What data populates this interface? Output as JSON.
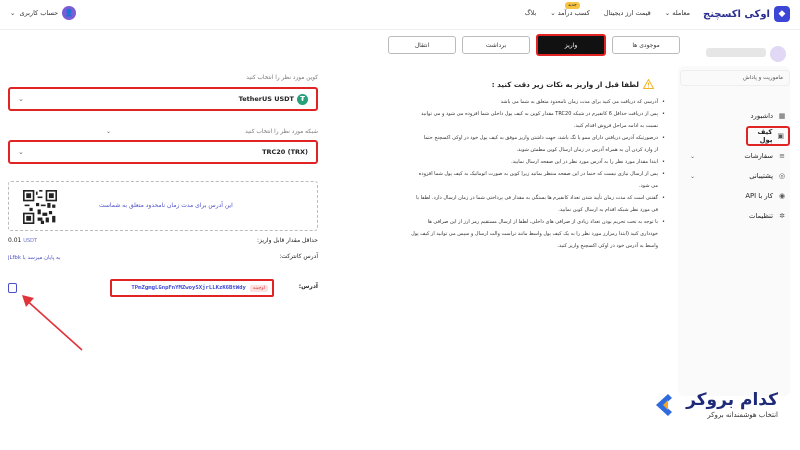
{
  "nav": {
    "logo_text": "اوکی اکسچنج",
    "links": [
      "معامله",
      "قیمت ارز دیجیتال",
      "کسب درآمد",
      "بلاگ"
    ],
    "new_badge": "جدید",
    "user_label": "حساب کاربری"
  },
  "sidebar": {
    "user_hint": "ماموریت و پاداش",
    "items": [
      {
        "label": "داشبورد",
        "icon": "dashboard-icon"
      },
      {
        "label": "کیف پول",
        "icon": "wallet-icon"
      },
      {
        "label": "سفارشات",
        "icon": "orders-icon"
      },
      {
        "label": "پشتیبانی",
        "icon": "support-icon"
      },
      {
        "label": "کار با API",
        "icon": "api-icon"
      },
      {
        "label": "تنظیمات",
        "icon": "settings-icon"
      }
    ]
  },
  "tabs": [
    "موجودی ها",
    "واریز",
    "برداشت",
    "انتقال"
  ],
  "notice": {
    "title": "لطفا قبل از واریز به نکات زیر دقت کنید :",
    "items": [
      "آدرسی که دریافت می کنید برای مدت زمان نامحدود متعلق به شما می باشد",
      "پس از دریافت حداقل 6 کانفیرم در شبکه TRC20 مقدار کوین به کیف پول داخلی شما افزوده می شود و می توانید",
      "نسبت به ادامه مراحل فروش اقدام کنید.",
      "درصورتیکه آدرس دریافتی دارای ممو یا تگ باشد، جهت داشتن واریز موفق به کیف پول خود در اوکی اکسچنج حتما",
      "از وارد کردن آن به همراه آدرس در زمان ارسال کوین مطمئن شوید.",
      "ابتدا مقدار مورد نظر را به آدرس مورد نظر در این صفحه ارسال نمایید.",
      "پس از ارسال نیازی نیست که حتما در این صفحه منتظر بمانید زیرا کوین به صورت اتوماتیک به کیف پول شما افزوده",
      "می شود.",
      "گفتنی است که مدت زمان تأیید شدن تعداد کانفیرم ها بستگی به مقدار فی پرداختی شما در زمان ارسال دارد. لطفا با",
      "فی مورد نظر شبکه اقدام به ارسال کوین نمایید.",
      "با توجه به تحت تحریم بودن تعداد زیادی از صرافی های داخلی، لطفا از ارسال مستقیم رمز ارز از این صرافی ها",
      "خودداری کنید (ابتدا رمزارز مورد نظر را به یک کیف پول واسط مانند تراست والت ارسال و سپس می توانید از کیف پول",
      "واسط به آدرس خود در اوکی اکسچنج واریز کنید."
    ]
  },
  "form": {
    "coin_label": "کوین مورد نظر را انتخاب کنید",
    "coin_value": "TetherUS USDT",
    "network_label": "شبکه مورد نظر را انتخاب کنید",
    "network_value": "TRC20 (TRX)",
    "qr_text": "این آدرس برای مدت زمان نامحدود متعلق به شماست",
    "min_label": "حداقل مقدار قابل واریز:",
    "min_value": "0.01",
    "min_unit": "USDT",
    "contract_label": "آدرس کانترکت:",
    "contract_link": "به پایان میرسد با jLfbk",
    "address_label": "آدرس:",
    "address_pill": "اوچینه",
    "address_value": "TPmZgmgLGnpFnYMZwoySXjrLLKzK6BtWdy"
  },
  "brand": {
    "name": "کدام بروکر",
    "tagline": "انتخاب هوشمندانه بروکر"
  },
  "colors": {
    "accent": "#3b46d6",
    "highlight": "#e02424",
    "annotation_arrow": "#e0343a"
  }
}
